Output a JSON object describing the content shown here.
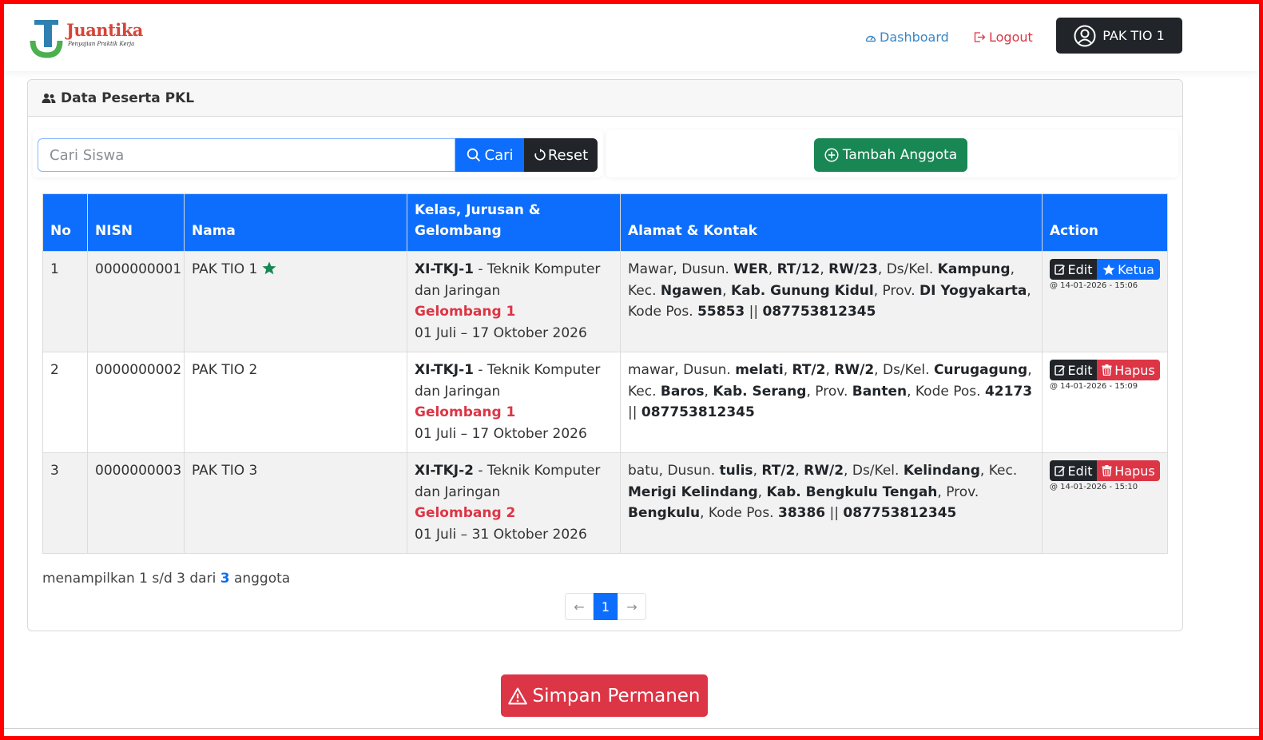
{
  "brand": {
    "name": "Juantika",
    "tagline": "Penyajian Praktik Kerja",
    "colors": {
      "primary": "#0d6efd",
      "success": "#198754",
      "danger": "#dc3545",
      "dark": "#212529"
    }
  },
  "nav": {
    "dashboard_label": "Dashboard",
    "dashboard_icon": "speedometer-icon",
    "logout_label": "Logout",
    "logout_icon": "logout-icon",
    "user_label": "PAK TIO 1",
    "user_icon": "user-circle-icon"
  },
  "card": {
    "title": "Data Peserta PKL",
    "title_icon": "people-icon"
  },
  "search": {
    "placeholder": "Cari Siswa",
    "value": "",
    "search_label": "Cari",
    "reset_label": "Reset"
  },
  "add_button_label": "Tambah Anggota",
  "table": {
    "headers": {
      "no": "No",
      "nisn": "NISN",
      "nama": "Nama",
      "kelas_l1": "Kelas, Jurusan &",
      "kelas_l2": "Gelombang",
      "alamat": "Alamat & Kontak",
      "action": "Action"
    },
    "rows": [
      {
        "no": "1",
        "nisn": "0000000001",
        "nama": "PAK TIO 1",
        "is_ketua": true,
        "kelas": "XI-TKJ-1",
        "jurusan": " - Teknik Komputer dan Jaringan",
        "gelombang": "Gelombang 1",
        "periode": "01 Juli – 17 Oktober 2026",
        "alamat": {
          "a1": "Mawar, Dusun. ",
          "dusun": "WER",
          "a2": ", ",
          "rt": "RT/12",
          "a3": ", ",
          "rw": "RW/23",
          "a4": ", Ds/Kel. ",
          "desa": "Kampung",
          "a5": ", Kec. ",
          "kec": "Ngawen",
          "a6": ", ",
          "kab": "Kab. Gunung Kidul",
          "a7": ", Prov. ",
          "prov": "DI Yogyakarta",
          "a8": ", Kode Pos. ",
          "kodepos": "55853",
          "a9": " || ",
          "telp": "087753812345"
        },
        "edit_label": "Edit",
        "second_label": "Ketua",
        "timestamp": "@ 14-01-2026 - 15:06"
      },
      {
        "no": "2",
        "nisn": "0000000002",
        "nama": "PAK TIO 2",
        "is_ketua": false,
        "kelas": "XI-TKJ-1",
        "jurusan": " - Teknik Komputer dan Jaringan",
        "gelombang": "Gelombang 1",
        "periode": "01 Juli – 17 Oktober 2026",
        "alamat": {
          "a1": "mawar, Dusun. ",
          "dusun": "melati",
          "a2": ", ",
          "rt": "RT/2",
          "a3": ", ",
          "rw": "RW/2",
          "a4": ", Ds/Kel. ",
          "desa": "Curugagung",
          "a5": ", Kec. ",
          "kec": "Baros",
          "a6": ", ",
          "kab": "Kab. Serang",
          "a7": ", Prov. ",
          "prov": "Banten",
          "a8": ", Kode Pos. ",
          "kodepos": "42173",
          "a9": " || ",
          "telp": "087753812345"
        },
        "edit_label": "Edit",
        "second_label": "Hapus",
        "timestamp": "@ 14-01-2026 - 15:09"
      },
      {
        "no": "3",
        "nisn": "0000000003",
        "nama": "PAK TIO 3",
        "is_ketua": false,
        "kelas": "XI-TKJ-2",
        "jurusan": " - Teknik Komputer dan Jaringan",
        "gelombang": "Gelombang 2",
        "periode": "01 Juli – 31 Oktober 2026",
        "alamat": {
          "a1": "batu, Dusun. ",
          "dusun": "tulis",
          "a2": ", ",
          "rt": "RT/2",
          "a3": ", ",
          "rw": "RW/2",
          "a4": ", Ds/Kel. ",
          "desa": "Kelindang",
          "a5": ", Kec. ",
          "kec": "Merigi Kelindang",
          "a6": ", ",
          "kab": "Kab. Bengkulu Tengah",
          "a7": ", Prov. ",
          "prov": "Bengkulu",
          "a8": ", Kode Pos. ",
          "kodepos": "38386",
          "a9": " || ",
          "telp": "087753812345"
        },
        "edit_label": "Edit",
        "second_label": "Hapus",
        "timestamp": "@ 14-01-2026 - 15:10"
      }
    ]
  },
  "footer": {
    "info_prefix": "menampilkan 1 s/d 3 dari ",
    "total": "3",
    "info_suffix": " anggota"
  },
  "pagination": {
    "prev": "←",
    "current": "1",
    "next": "→"
  },
  "save_button_label": "Simpan Permanen"
}
